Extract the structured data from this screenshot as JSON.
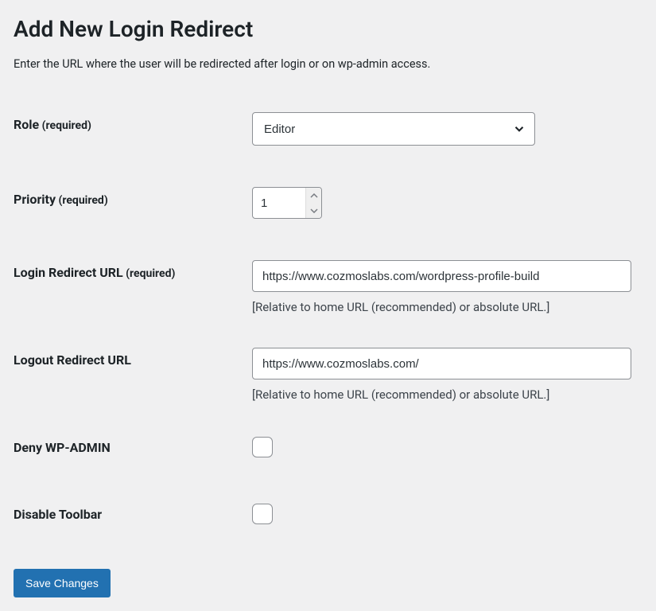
{
  "page": {
    "title": "Add New Login Redirect",
    "description": "Enter the URL where the user will be redirected after login or on wp-admin access."
  },
  "fields": {
    "role": {
      "label_main": "Role",
      "label_required": " (required)",
      "value": "Editor"
    },
    "priority": {
      "label_main": "Priority",
      "label_required": " (required)",
      "value": "1"
    },
    "login_redirect": {
      "label_main": "Login Redirect URL",
      "label_required": " (required)",
      "value": "https://www.cozmoslabs.com/wordpress-profile-build",
      "hint": "[Relative to home URL (recommended) or absolute URL.]"
    },
    "logout_redirect": {
      "label_main": "Logout Redirect URL",
      "value": "https://www.cozmoslabs.com/",
      "hint": "[Relative to home URL (recommended) or absolute URL.]"
    },
    "deny_wpadmin": {
      "label_main": "Deny WP-ADMIN",
      "checked": false
    },
    "disable_toolbar": {
      "label_main": "Disable Toolbar",
      "checked": false
    }
  },
  "actions": {
    "save": "Save Changes"
  }
}
